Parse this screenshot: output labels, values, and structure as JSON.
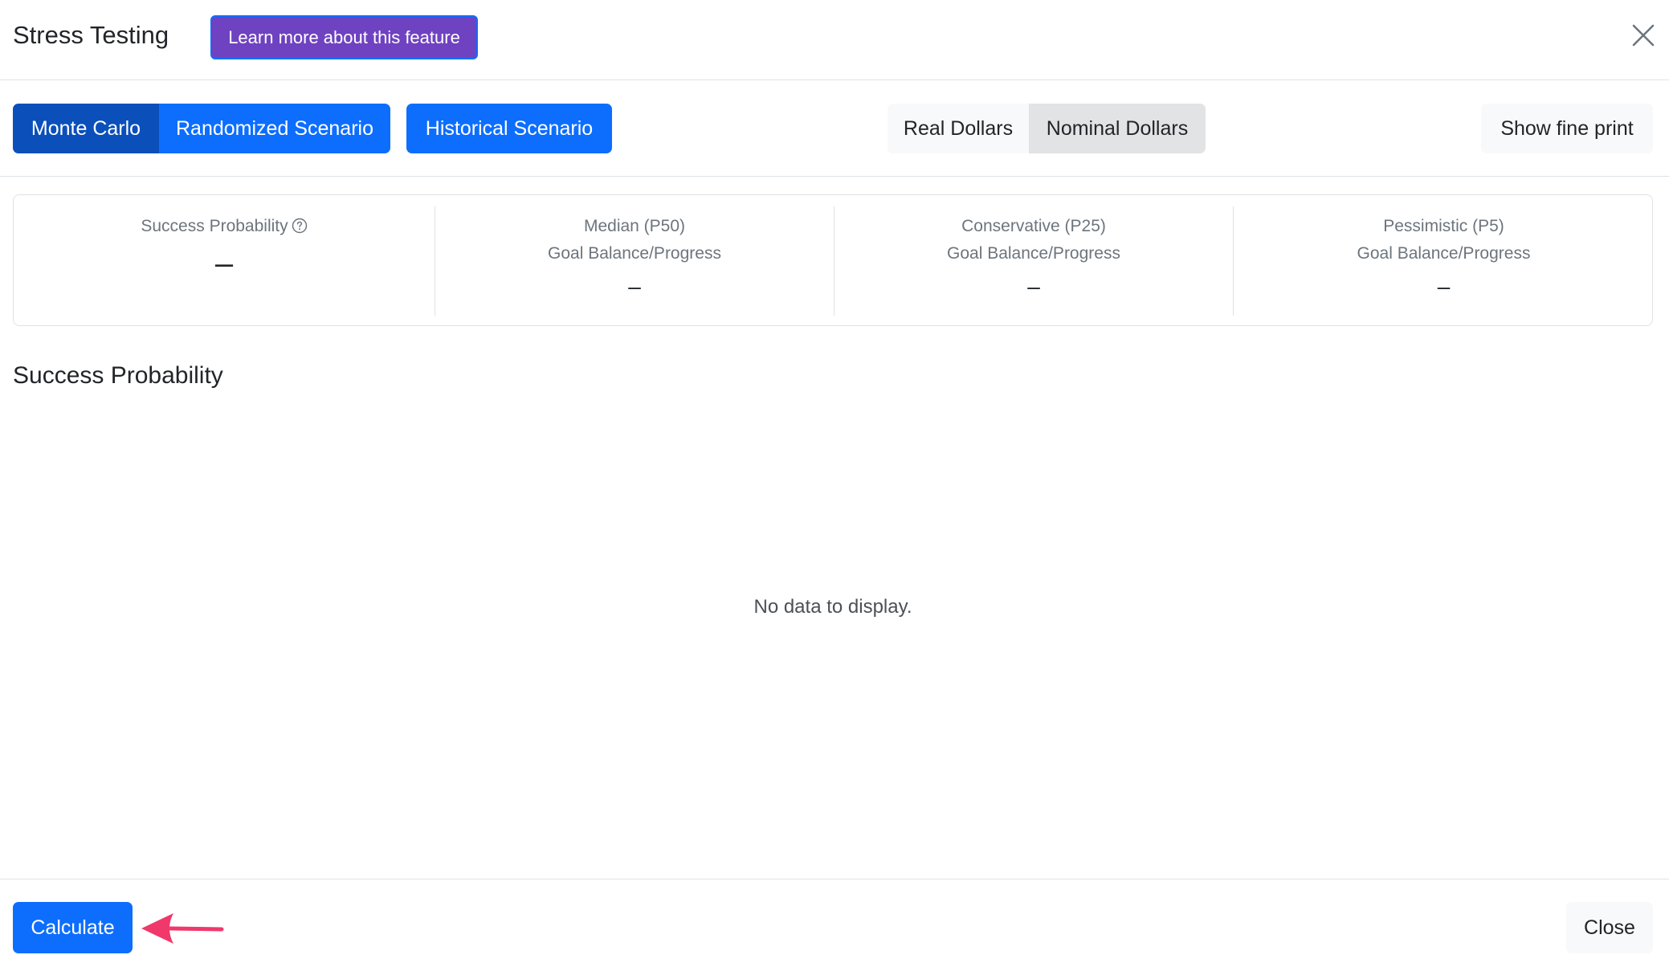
{
  "header": {
    "title": "Stress Testing",
    "learn_more_label": "Learn more about this feature",
    "close_icon": "close-x-icon"
  },
  "toolbar": {
    "method_tabs": [
      "Monte Carlo",
      "Randomized Scenario"
    ],
    "historical_label": "Historical Scenario",
    "dollar_toggle": [
      "Real Dollars",
      "Nominal Dollars"
    ],
    "selected_dollar": "Nominal Dollars",
    "selected_method": "Monte Carlo",
    "fine_print_label": "Show fine print"
  },
  "stats": {
    "success": {
      "label": "Success Probability",
      "value": "–"
    },
    "median": {
      "label": "Median (P50)",
      "sub": "Goal Balance/Progress",
      "value": "–"
    },
    "conservative": {
      "label": "Conservative (P25)",
      "sub": "Goal Balance/Progress",
      "value": "–"
    },
    "pessimistic": {
      "label": "Pessimistic (P5)",
      "sub": "Goal Balance/Progress",
      "value": "–"
    }
  },
  "section": {
    "title": "Success Probability",
    "empty_message": "No data to display."
  },
  "footer": {
    "calculate_label": "Calculate",
    "close_label": "Close"
  },
  "colors": {
    "primary": "#0d6efd",
    "primary_active": "#0b4fba",
    "purple": "#6f42c1",
    "annotation_arrow": "#f0386b"
  }
}
